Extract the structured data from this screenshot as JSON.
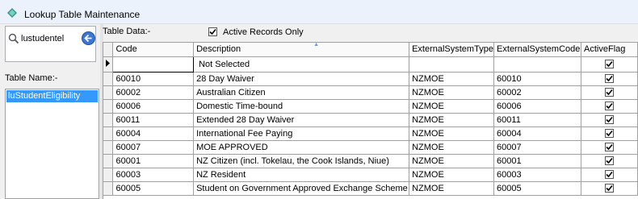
{
  "window": {
    "title": "Lookup Table Maintenance"
  },
  "search": {
    "value": "lustudentel"
  },
  "left": {
    "table_name_label": "Table Name:-",
    "tables": [
      "luStudentEligibility"
    ]
  },
  "main": {
    "table_data_label": "Table Data:-",
    "active_only_label": "Active Records Only",
    "active_only_checked": true
  },
  "grid": {
    "columns": [
      "Code",
      "Description",
      "ExternalSystemType",
      "ExternalSystemCode",
      "ActiveFlag"
    ],
    "new_row": {
      "code": "",
      "description": "Not Selected",
      "ext_type": "",
      "ext_code": "",
      "active": true
    },
    "rows": [
      {
        "code": "60010",
        "description": "28 Day Waiver",
        "ext_type": "NZMOE",
        "ext_code": "60010",
        "active": true
      },
      {
        "code": "60002",
        "description": "Australian Citizen",
        "ext_type": "NZMOE",
        "ext_code": "60002",
        "active": true
      },
      {
        "code": "60006",
        "description": "Domestic Time-bound",
        "ext_type": "NZMOE",
        "ext_code": "60006",
        "active": true
      },
      {
        "code": "60011",
        "description": "Extended 28 Day Waiver",
        "ext_type": "NZMOE",
        "ext_code": "60011",
        "active": true
      },
      {
        "code": "60004",
        "description": "International Fee Paying",
        "ext_type": "NZMOE",
        "ext_code": "60004",
        "active": true
      },
      {
        "code": "60007",
        "description": "MOE APPROVED",
        "ext_type": "NZMOE",
        "ext_code": "60007",
        "active": true
      },
      {
        "code": "60001",
        "description": "NZ Citizen (incl. Tokelau, the Cook Islands, Niue)",
        "ext_type": "NZMOE",
        "ext_code": "60001",
        "active": true
      },
      {
        "code": "60003",
        "description": "NZ Resident",
        "ext_type": "NZMOE",
        "ext_code": "60003",
        "active": true
      },
      {
        "code": "60005",
        "description": "Student on Government Approved Exchange Scheme",
        "ext_type": "NZMOE",
        "ext_code": "60005",
        "active": true
      }
    ]
  }
}
